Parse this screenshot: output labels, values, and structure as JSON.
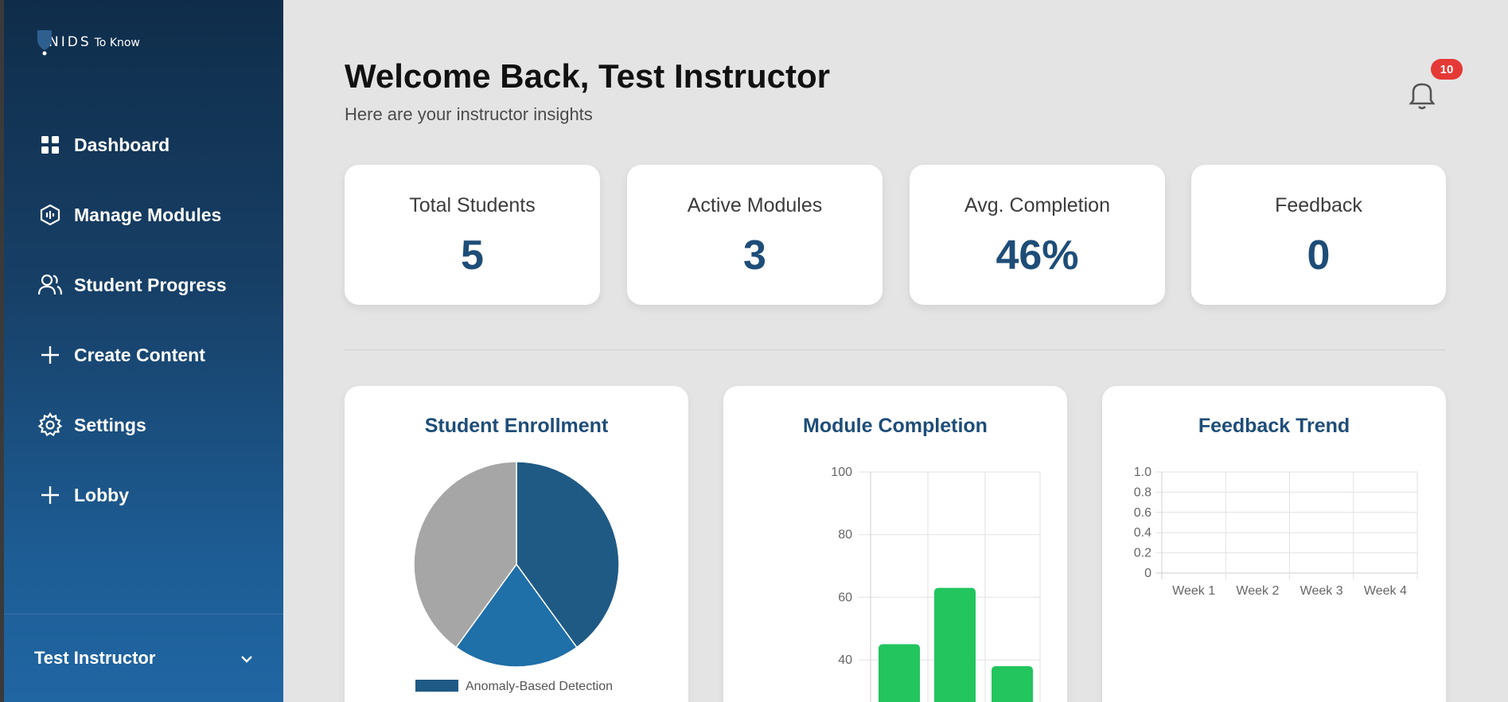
{
  "sidebar": {
    "logo": {
      "brand": "NIDS",
      "tagline": "To Know"
    },
    "items": [
      {
        "label": "Dashboard",
        "icon": "grid-icon"
      },
      {
        "label": "Manage Modules",
        "icon": "module-icon"
      },
      {
        "label": "Student Progress",
        "icon": "users-icon"
      },
      {
        "label": "Create Content",
        "icon": "plus-icon"
      },
      {
        "label": "Settings",
        "icon": "gear-icon"
      },
      {
        "label": "Lobby",
        "icon": "plus-icon"
      }
    ],
    "user": {
      "name": "Test Instructor",
      "icon": "chevron-down-icon"
    }
  },
  "header": {
    "title": "Welcome Back, Test Instructor",
    "subtitle": "Here are your instructor insights",
    "notification_count": "10"
  },
  "stats": [
    {
      "label": "Total Students",
      "value": "5"
    },
    {
      "label": "Active Modules",
      "value": "3"
    },
    {
      "label": "Avg. Completion",
      "value": "46%"
    },
    {
      "label": "Feedback",
      "value": "0"
    }
  ],
  "charts": {
    "enrollment_title": "Student Enrollment",
    "completion_title": "Module Completion",
    "feedback_title": "Feedback Trend"
  },
  "colors": {
    "accent": "#1e4d78",
    "pie": [
      "#1f5a85",
      "#1f6fa8",
      "#a6a6a6"
    ],
    "bar": "#22c55e",
    "badge": "#e53935"
  },
  "chart_data": [
    {
      "type": "pie",
      "title": "Student Enrollment",
      "slices": [
        {
          "name": "Anomaly-Based Detection",
          "value": 2
        },
        {
          "name": "",
          "value": 1
        },
        {
          "name": "",
          "value": 2
        }
      ],
      "legend_visible": [
        "Anomaly-Based Detection"
      ]
    },
    {
      "type": "bar",
      "title": "Module Completion",
      "values": [
        45,
        63,
        38
      ],
      "ylim": [
        0,
        100
      ],
      "y_ticks_visible": [
        100,
        80,
        60,
        40
      ],
      "grid": true
    },
    {
      "type": "line",
      "title": "Feedback Trend",
      "categories": [
        "Week 1",
        "Week 2",
        "Week 3",
        "Week 4"
      ],
      "values": [],
      "y_ticks": [
        "1.0",
        "0.8",
        "0.6",
        "0.4",
        "0.2",
        "0"
      ],
      "grid": true
    }
  ]
}
